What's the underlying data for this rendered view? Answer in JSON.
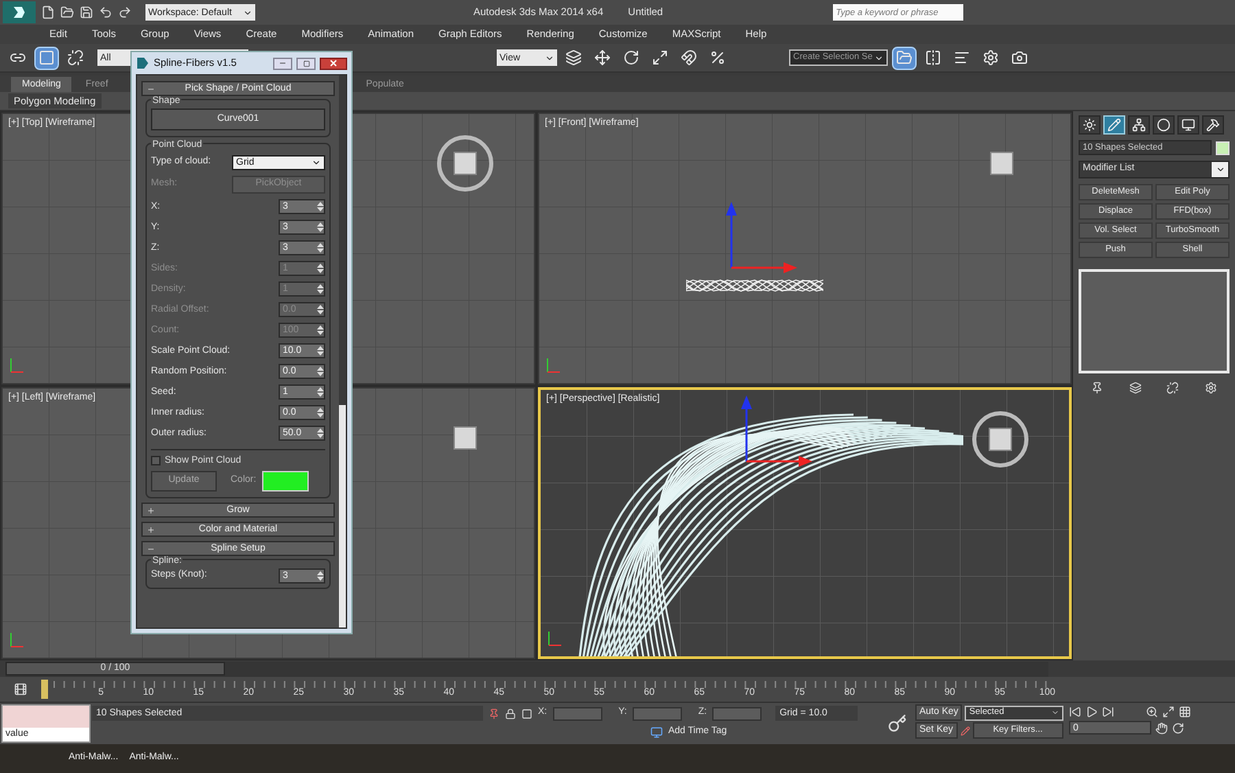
{
  "title_bar": {
    "workspace": "Workspace: Default",
    "app_title": "Autodesk 3ds Max 2014 x64",
    "document": "Untitled",
    "search": {
      "placeholder": "Type a keyword or phrase"
    }
  },
  "menu": [
    "Edit",
    "Tools",
    "Group",
    "Views",
    "Create",
    "Modifiers",
    "Animation",
    "Graph Editors",
    "Rendering",
    "Customize",
    "MAXScript",
    "Help"
  ],
  "toolbar": {
    "filter": "All",
    "reference": "View",
    "selection_set": "Create Selection Se",
    "buttons": [
      {
        "selected": false
      },
      {
        "selected": true
      },
      {
        "selected": false
      },
      {
        "selected": false
      },
      {
        "selected": false
      },
      {
        "selected": false
      },
      {
        "selected": false
      },
      {
        "selected": false
      },
      {
        "selected": false
      },
      {
        "selected": true
      },
      {
        "selected": false
      },
      {
        "selected": false
      },
      {
        "selected": false
      },
      {
        "selected": false
      }
    ]
  },
  "ribbon": {
    "tabs": [
      {
        "label": "Modeling",
        "selected": true
      },
      {
        "label": "Freef",
        "selected": false
      },
      {
        "label": "Populate",
        "selected": false
      }
    ],
    "panel": "Polygon Modeling"
  },
  "viewports": [
    {
      "label": "[+] [Top] [Wireframe]",
      "kind": "top",
      "active": false
    },
    {
      "label": "[+] [Front] [Wireframe]",
      "kind": "front",
      "active": false
    },
    {
      "label": "[+] [Left] [Wireframe]",
      "kind": "left",
      "active": false
    },
    {
      "label": "[+] [Perspective] [Realistic]",
      "kind": "perspective",
      "active": true
    }
  ],
  "dialog": {
    "title": "Spline-Fibers v1.5",
    "rollouts": [
      {
        "title": "Pick Shape / Point Cloud",
        "expanded": true,
        "kind": "pick"
      },
      {
        "title": "Grow",
        "expanded": false,
        "kind": "plain"
      },
      {
        "title": "Color and Material",
        "expanded": false,
        "kind": "plain"
      },
      {
        "title": "Spline Setup",
        "expanded": true,
        "kind": "spline"
      }
    ],
    "shape_group": "Shape",
    "shape_button": "Curve001",
    "cloud_group": "Point Cloud",
    "cloud_type_label": "Type of cloud:",
    "cloud_type": "Grid",
    "mesh": {
      "label": "Mesh:",
      "button": "PickObject",
      "disabled": true
    },
    "params": [
      {
        "label": "X:",
        "value": "3",
        "disabled": false
      },
      {
        "label": "Y:",
        "value": "3",
        "disabled": false
      },
      {
        "label": "Z:",
        "value": "3",
        "disabled": false
      },
      {
        "label": "Sides:",
        "value": "1",
        "disabled": true
      },
      {
        "label": "Density:",
        "value": "1",
        "disabled": true
      },
      {
        "label": "Radial Offset:",
        "value": "0.0",
        "disabled": true
      },
      {
        "label": "Count:",
        "value": "100",
        "disabled": true
      },
      {
        "label": "Scale Point Cloud:",
        "value": "10.0",
        "disabled": false
      },
      {
        "label": "Random Position:",
        "value": "0.0",
        "disabled": false
      },
      {
        "label": "Seed:",
        "value": "1",
        "disabled": false
      },
      {
        "label": "Inner radius:",
        "value": "0.0",
        "disabled": false
      },
      {
        "label": "Outer radius:",
        "value": "50.0",
        "disabled": false
      }
    ],
    "show_cloud": {
      "label": "Show Point Cloud",
      "checked": false
    },
    "update_button": "Update",
    "color_label": "Color:",
    "color": "#22ee22",
    "spline_group": "Spline:",
    "steps": {
      "label": "Steps (Knot):",
      "value": "3"
    }
  },
  "command_panel": {
    "tabs": [
      {
        "selected": false
      },
      {
        "selected": true
      },
      {
        "selected": false
      },
      {
        "selected": false
      },
      {
        "selected": false
      },
      {
        "selected": false
      }
    ],
    "selection": "10 Shapes Selected",
    "color": "#c8f0b4",
    "modifier_list": "Modifier List",
    "modifiers": [
      "DeleteMesh",
      "Edit Poly",
      "Displace",
      "FFD(box)",
      "Vol. Select",
      "TurboSmooth",
      "Push",
      "Shell"
    ]
  },
  "timeline": {
    "frame": "0 / 100",
    "level": 0,
    "ticks": [
      "5",
      "10",
      "15",
      "20",
      "25",
      "30",
      "35",
      "40",
      "45",
      "50",
      "55",
      "60",
      "65",
      "70",
      "75",
      "80",
      "85",
      "90",
      "95",
      "100"
    ]
  },
  "status": {
    "listener": "value",
    "selection": "10 Shapes Selected",
    "x_label": "X:",
    "y_label": "Y:",
    "z_label": "Z:",
    "grid": "Grid = 10.0",
    "time_tag": "Add Time Tag",
    "auto_key": "Auto Key",
    "key_mode": "Selected",
    "set_key": "Set Key",
    "key_filters": "Key Filters...",
    "frame": "0"
  },
  "taskbar": [
    "Anti-Malw...",
    "Anti-Malw..."
  ]
}
